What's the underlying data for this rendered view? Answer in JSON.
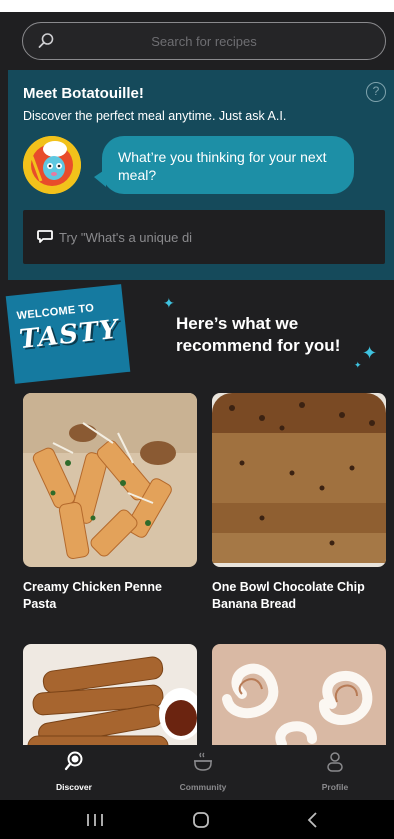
{
  "search": {
    "placeholder": "Search for recipes",
    "icon": "search-icon"
  },
  "bot_panel": {
    "title": "Meet Botatouille!",
    "subtitle": "Discover the perfect meal anytime. Just ask A.I.",
    "help_icon": "?",
    "bubble_text": "What’re you thinking for your next meal?",
    "input_placeholder": "Try \"What's a unique di"
  },
  "welcome": {
    "badge_small": "WELCOME TO",
    "badge_logo": "TASTY",
    "recommend_text": "Here’s what we recommend for you!"
  },
  "recipes": [
    {
      "title": "Creamy Chicken Penne Pasta"
    },
    {
      "title": "One Bowl Chocolate Chip Banana Bread"
    }
  ],
  "bottom_nav": [
    {
      "label": "Discover",
      "icon": "discover-icon",
      "active": true
    },
    {
      "label": "Community",
      "icon": "community-icon",
      "active": false
    },
    {
      "label": "Profile",
      "icon": "profile-icon",
      "active": false
    }
  ],
  "colors": {
    "panel": "#154a5b",
    "bubble": "#1d8fa6",
    "badge": "#157aa0",
    "background": "#1f1f21"
  }
}
